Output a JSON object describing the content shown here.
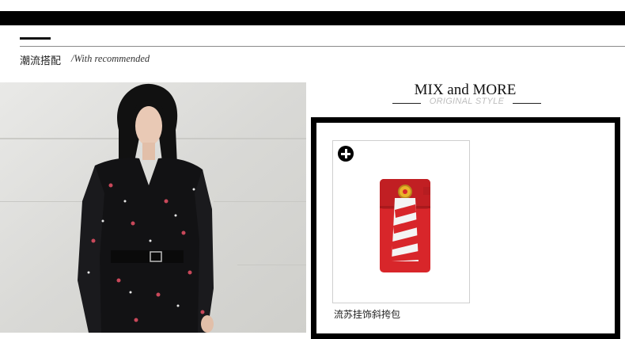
{
  "section": {
    "title": "潮流搭配",
    "subtitle": "/With recommended"
  },
  "mix": {
    "title": "MIX and MORE",
    "subtitle": "ORIGINAL STYLE"
  },
  "product": {
    "name": "流苏挂饰斜挎包",
    "add_icon": "plus-circle-icon",
    "bag_color": "#d8262a"
  },
  "colors": {
    "bar": "#000000",
    "rule": "#8a8a8a",
    "subtle_text": "#bdbdbd"
  }
}
